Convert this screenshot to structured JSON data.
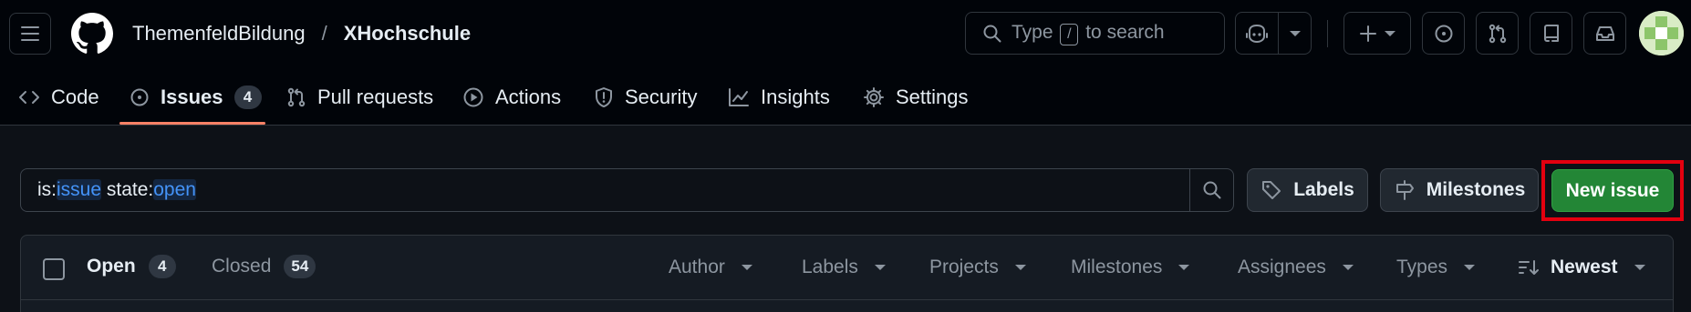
{
  "header": {
    "owner": "ThemenfeldBildung",
    "separator": "/",
    "repo": "XHochschule",
    "search": {
      "prefix": "Type",
      "key": "/",
      "suffix": "to search"
    }
  },
  "tabs": [
    {
      "label": "Code",
      "icon": "code-icon"
    },
    {
      "label": "Issues",
      "icon": "issue-opened-icon",
      "count": "4",
      "selected": true
    },
    {
      "label": "Pull requests",
      "icon": "git-pull-request-icon"
    },
    {
      "label": "Actions",
      "icon": "play-icon"
    },
    {
      "label": "Security",
      "icon": "shield-icon"
    },
    {
      "label": "Insights",
      "icon": "graph-icon"
    },
    {
      "label": "Settings",
      "icon": "gear-icon"
    }
  ],
  "filter": {
    "tokens": [
      {
        "text": "is:",
        "highlight": false
      },
      {
        "text": "issue",
        "highlight": true
      },
      {
        "text": " state:",
        "highlight": false
      },
      {
        "text": "open",
        "highlight": true
      }
    ],
    "labels_button": "Labels",
    "milestones_button": "Milestones",
    "new_issue_button": "New issue"
  },
  "list_header": {
    "open_label": "Open",
    "open_count": "4",
    "closed_label": "Closed",
    "closed_count": "54",
    "filters": [
      "Author",
      "Labels",
      "Projects",
      "Milestones",
      "Assignees",
      "Types"
    ],
    "sort_label": "Newest"
  },
  "colors": {
    "background": "#0d1117",
    "header_background": "#010409",
    "primary_button": "#238636",
    "selected_tab_underline": "#f78166",
    "highlight_box": "#e3000f",
    "link_token": "#4493f8"
  }
}
